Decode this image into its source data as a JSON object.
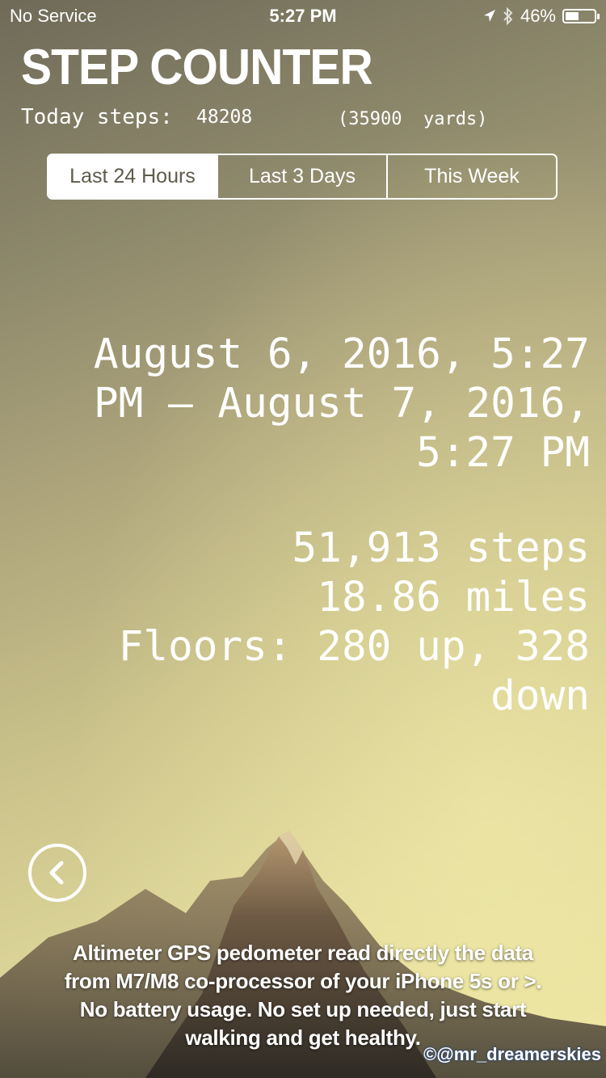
{
  "status_bar": {
    "carrier": "No Service",
    "time": "5:27 PM",
    "battery_percent": "46%",
    "battery_level": 0.46,
    "icons": [
      "location-arrow-icon",
      "bluetooth-icon",
      "battery-icon"
    ]
  },
  "header": {
    "title": "STEP COUNTER",
    "today_label": "Today steps:",
    "today_value": "48208",
    "today_yards": "(35900  yards)"
  },
  "tabs": [
    {
      "label": "Last 24 Hours",
      "active": true
    },
    {
      "label": "Last 3 Days",
      "active": false
    },
    {
      "label": "This Week",
      "active": false
    }
  ],
  "main": {
    "period": "August 6, 2016, 5:27\nPM – August 7, 2016,\n5:27 PM",
    "stats": "51,913 steps\n18.86 miles\nFloors: 280 up, 328\ndown"
  },
  "footer": {
    "back_icon": "chevron-left-circle-icon",
    "description": "Altimeter GPS pedometer read directly the data\nfrom M7/M8 co-processor of your iPhone 5s or >.\nNo battery usage. No set up needed, just start\nwalking and get healthy.",
    "watermark": "©@mr_dreamerskies"
  },
  "colors": {
    "active_tab_text": "#5e5b4c",
    "background_top": "#6f6a58",
    "background_bottom": "#ece49e"
  }
}
